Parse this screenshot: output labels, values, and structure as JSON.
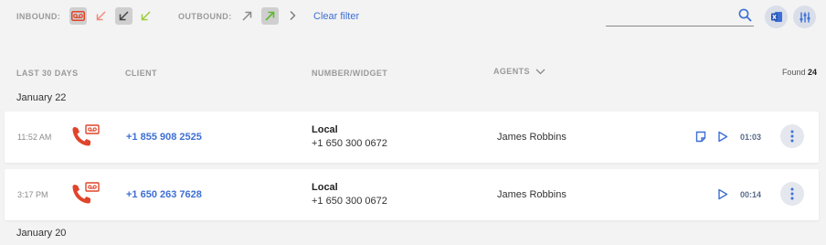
{
  "filters": {
    "inbound_label": "INBOUND:",
    "outbound_label": "OUTBOUND:",
    "clear_filter": "Clear filter"
  },
  "search": {
    "value": "",
    "placeholder": ""
  },
  "columns": {
    "period": "LAST 30 DAYS",
    "client": "CLIENT",
    "number_widget": "NUMBER/WIDGET",
    "agents": "AGENTS"
  },
  "found": {
    "label": "Found",
    "count": "24"
  },
  "groups": [
    {
      "date": "January 22",
      "calls": [
        {
          "time": "11:52 AM",
          "client": "+1 855 908 2525",
          "widget_name": "Local",
          "widget_number": "+1 650 300 0672",
          "agent": "James Robbins",
          "duration": "01:03",
          "has_note": true
        },
        {
          "time": "3:17 PM",
          "client": "+1 650 263 7628",
          "widget_name": "Local",
          "widget_number": "+1 650 300 0672",
          "agent": "James Robbins",
          "duration": "00:14",
          "has_note": false
        }
      ]
    },
    {
      "date": "January 20",
      "calls": []
    }
  ],
  "colors": {
    "accent_blue": "#3d6fd4",
    "voicemail_red": "#e0452b",
    "inbound_missed": "#f08c7c",
    "inbound_answered": "#9ccc3c",
    "outbound_answered": "#5cb82e"
  },
  "icons": {
    "voicemail": "voicemail-icon",
    "missed": "missed-inbound-arrow-icon",
    "inbound": "inbound-arrow-icon",
    "outbound": "outbound-arrow-icon",
    "search": "search-icon",
    "excel": "excel-export-icon",
    "settings": "sliders-icon",
    "note": "note-icon",
    "play": "play-icon",
    "more": "more-vertical-icon"
  }
}
